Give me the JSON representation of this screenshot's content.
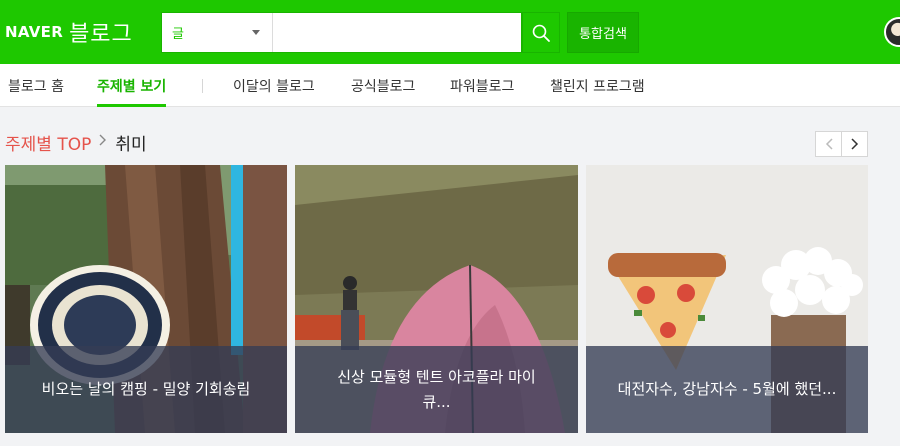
{
  "header": {
    "logo_naver": "NAVER",
    "logo_blog": "블로그",
    "search": {
      "selected_option": "글",
      "value": "",
      "placeholder": ""
    },
    "search_icon": "search-icon",
    "total_search_label": "통합검색",
    "brand_color": "#1ec800"
  },
  "nav": {
    "items": [
      {
        "label": "블로그 홈",
        "active": false
      },
      {
        "label": "주제별 보기",
        "active": true
      },
      {
        "label": "이달의 블로그",
        "active": false
      },
      {
        "label": "공식블로그",
        "active": false
      },
      {
        "label": "파워블로그",
        "active": false
      },
      {
        "label": "챌린지 프로그램",
        "active": false
      }
    ]
  },
  "section": {
    "title_top": "주제별 TOP",
    "category": "취미",
    "prev_icon": "chevron-left-icon",
    "next_icon": "chevron-right-icon"
  },
  "cards": [
    {
      "caption": "비오는 날의 캠핑 - 밀양 기회송림"
    },
    {
      "caption": "신상 모듈형 텐트 아코플라 마이큐..."
    },
    {
      "caption": "대전자수, 강남자수 - 5월에 했던..."
    }
  ]
}
